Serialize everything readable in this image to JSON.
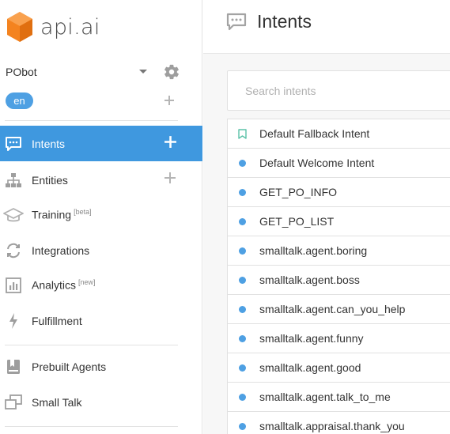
{
  "app": {
    "logo_text": "api.ai"
  },
  "agent": {
    "name": "PObot",
    "language": "en"
  },
  "sidebar": {
    "items": [
      {
        "label": "Intents",
        "badge": "",
        "icon": "chat-icon",
        "active": true,
        "has_add": true
      },
      {
        "label": "Entities",
        "badge": "",
        "icon": "hierarchy-icon",
        "active": false,
        "has_add": true
      },
      {
        "label": "Training",
        "badge": "[beta]",
        "icon": "graduation-cap-icon",
        "active": false,
        "has_add": false
      },
      {
        "label": "Integrations",
        "badge": "",
        "icon": "refresh-icon",
        "active": false,
        "has_add": false
      },
      {
        "label": "Analytics",
        "badge": "[new]",
        "icon": "bar-chart-icon",
        "active": false,
        "has_add": false
      },
      {
        "label": "Fulfillment",
        "badge": "",
        "icon": "lightning-icon",
        "active": false,
        "has_add": false
      },
      {
        "label": "Prebuilt Agents",
        "badge": "",
        "icon": "bookmark-icon",
        "active": false,
        "has_add": false
      },
      {
        "label": "Small Talk",
        "badge": "",
        "icon": "chat-windows-icon",
        "active": false,
        "has_add": false
      }
    ]
  },
  "main": {
    "title": "Intents",
    "search_placeholder": "Search intents",
    "intents": [
      {
        "name": "Default Fallback Intent",
        "marker": "bookmark"
      },
      {
        "name": "Default Welcome Intent",
        "marker": "dot"
      },
      {
        "name": "GET_PO_INFO",
        "marker": "dot"
      },
      {
        "name": "GET_PO_LIST",
        "marker": "dot"
      },
      {
        "name": "smalltalk.agent.boring",
        "marker": "dot"
      },
      {
        "name": "smalltalk.agent.boss",
        "marker": "dot"
      },
      {
        "name": "smalltalk.agent.can_you_help",
        "marker": "dot"
      },
      {
        "name": "smalltalk.agent.funny",
        "marker": "dot"
      },
      {
        "name": "smalltalk.agent.good",
        "marker": "dot"
      },
      {
        "name": "smalltalk.agent.talk_to_me",
        "marker": "dot"
      },
      {
        "name": "smalltalk.appraisal.thank_you",
        "marker": "dot"
      }
    ]
  },
  "colors": {
    "accent": "#3f98df",
    "dot": "#4ea0e3",
    "logo": "#f4831f",
    "icon_gray": "#9e9e9e"
  }
}
